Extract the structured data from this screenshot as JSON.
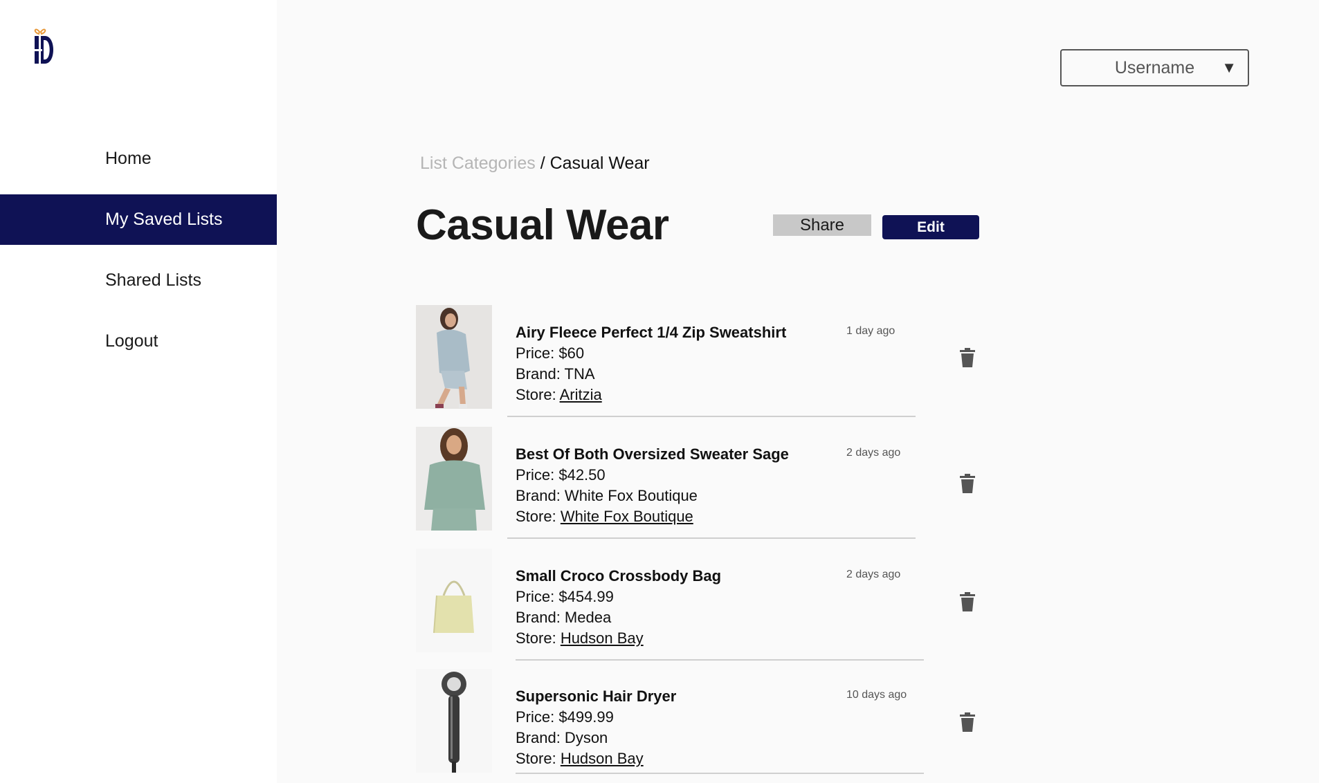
{
  "sidebar": {
    "items": [
      {
        "label": "Home"
      },
      {
        "label": "My Saved Lists"
      },
      {
        "label": "Shared Lists"
      },
      {
        "label": "Logout"
      }
    ]
  },
  "header": {
    "username": "Username",
    "caret": "▼"
  },
  "breadcrumb": {
    "parent": "List Categories",
    "separator": " / ",
    "current": "Casual Wear"
  },
  "page": {
    "title": "Casual Wear",
    "share_label": "Share",
    "edit_label": "Edit"
  },
  "items": [
    {
      "name": "Airy Fleece Perfect 1/4 Zip Sweatshirt",
      "time": "1 day ago",
      "price": "Price: $60",
      "brand": "Brand: TNA",
      "store_label": "Store: ",
      "store": "Aritzia"
    },
    {
      "name": "Best Of Both Oversized Sweater Sage",
      "time": "2 days ago",
      "price": "Price: $42.50",
      "brand": "Brand: White Fox Boutique",
      "store_label": "Store: ",
      "store": "White Fox Boutique"
    },
    {
      "name": "Small Croco Crossbody Bag",
      "time": "2 days ago",
      "price": "Price: $454.99",
      "brand": "Brand: Medea",
      "store_label": "Store: ",
      "store": "Hudson Bay"
    },
    {
      "name": "Supersonic Hair Dryer",
      "time": "10 days ago",
      "price": "Price: $499.99",
      "brand": "Brand: Dyson",
      "store_label": "Store: ",
      "store": "Hudson Bay"
    }
  ],
  "colors": {
    "accent": "#0f1255",
    "share_bg": "#c8c8c8",
    "breadcrumb_inactive": "#b5b5b5"
  },
  "icons": {
    "logo": "gift-logo-icon",
    "trash": "trash-icon"
  }
}
